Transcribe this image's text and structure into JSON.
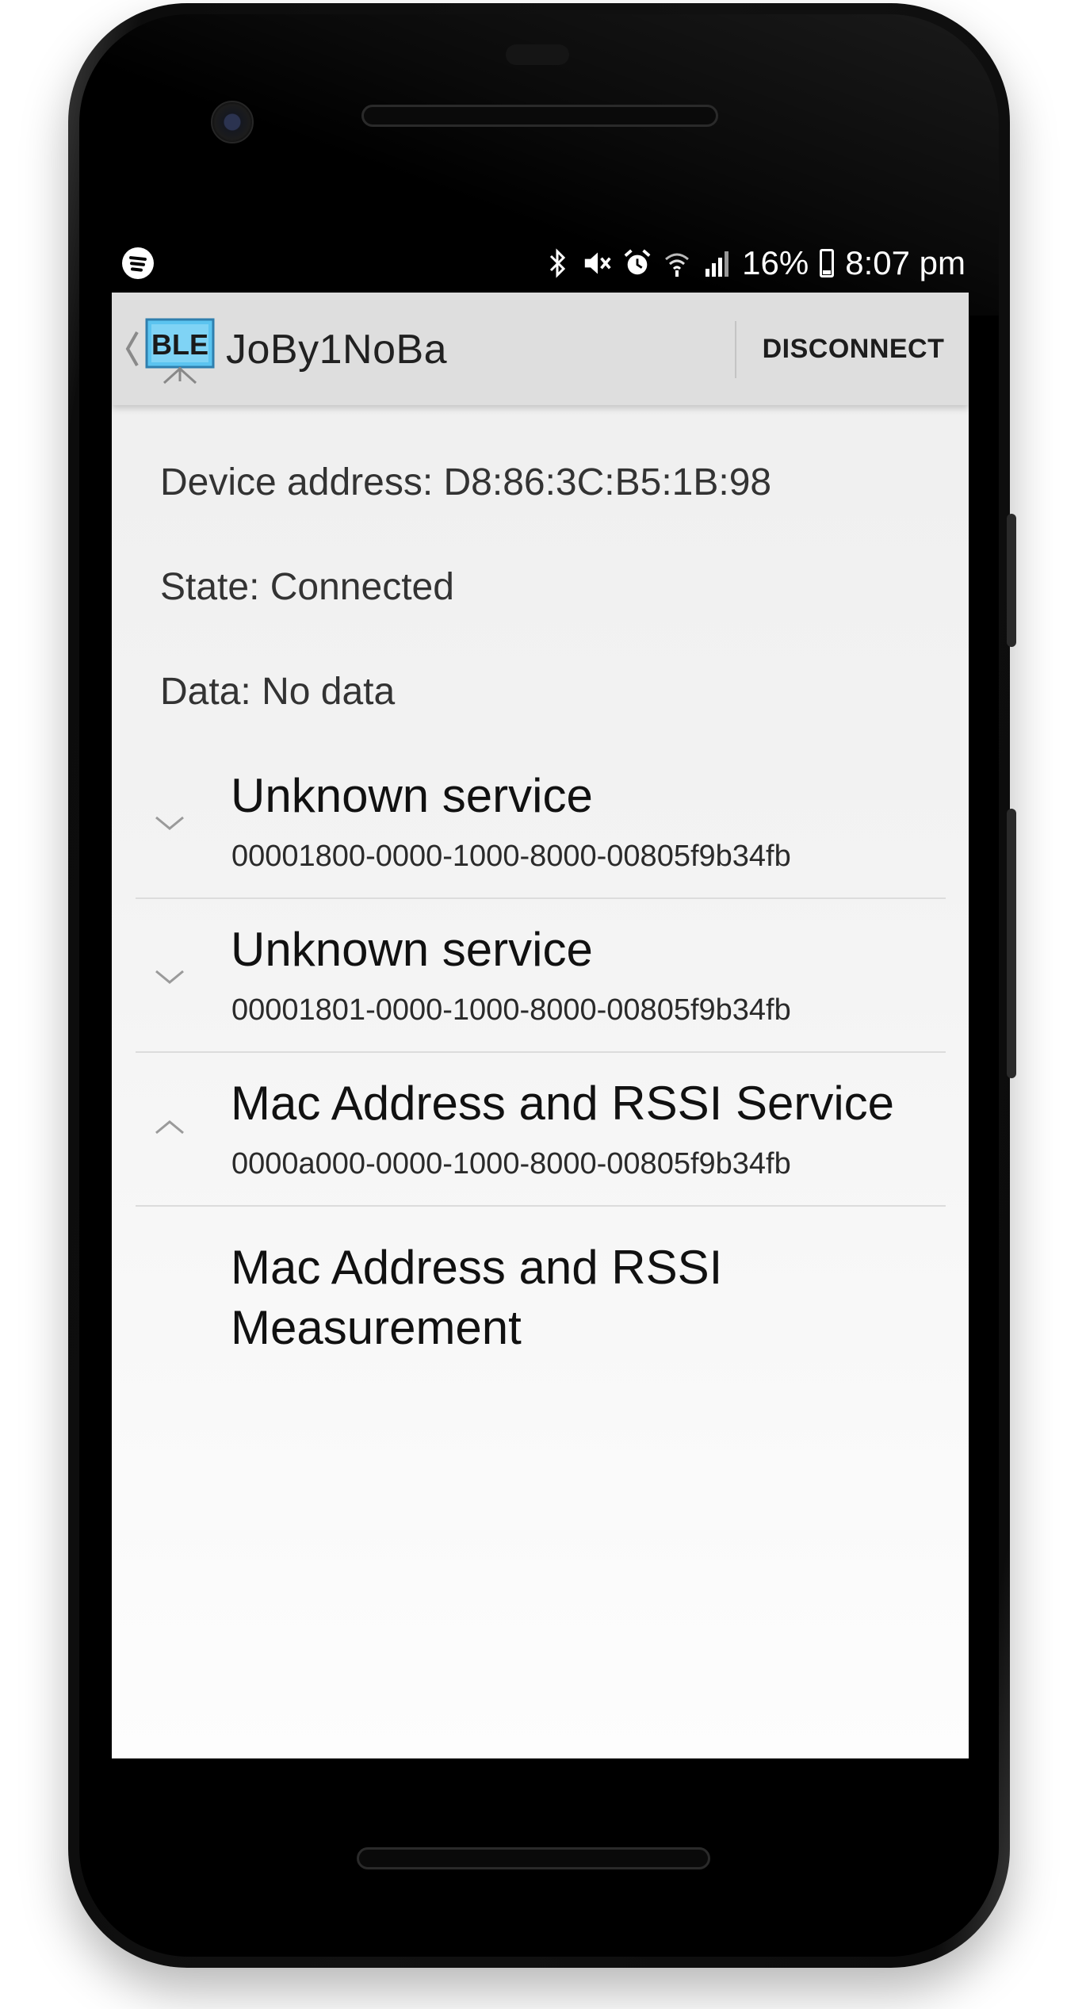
{
  "status_bar": {
    "battery_percent": "16%",
    "time": "8:07 pm",
    "icons": [
      "spotify-icon",
      "bluetooth-icon",
      "mute-icon",
      "alarm-icon",
      "wifi-icon",
      "signal-icon",
      "battery-icon"
    ]
  },
  "app_bar": {
    "logo_text": "BLE",
    "device_name": "JoBy1NoBa",
    "disconnect_label": "DISCONNECT"
  },
  "device_info": {
    "address": "Device address: D8:86:3C:B5:1B:98",
    "state": "State: Connected",
    "data": "Data: No data"
  },
  "services": [
    {
      "title": "Unknown service",
      "uuid": "00001800-0000-1000-8000-00805f9b34fb",
      "expanded": false
    },
    {
      "title": "Unknown service",
      "uuid": "00001801-0000-1000-8000-00805f9b34fb",
      "expanded": false
    },
    {
      "title": "Mac Address and RSSI Service",
      "uuid": "0000a000-0000-1000-8000-00805f9b34fb",
      "expanded": true
    }
  ],
  "characteristics": [
    {
      "title": "Mac Address and RSSI Measurement"
    }
  ],
  "colors": {
    "app_bar": "#dedede",
    "screen_background": "#f3f3f3",
    "ble_logo_blue": "#5bc4f0"
  }
}
